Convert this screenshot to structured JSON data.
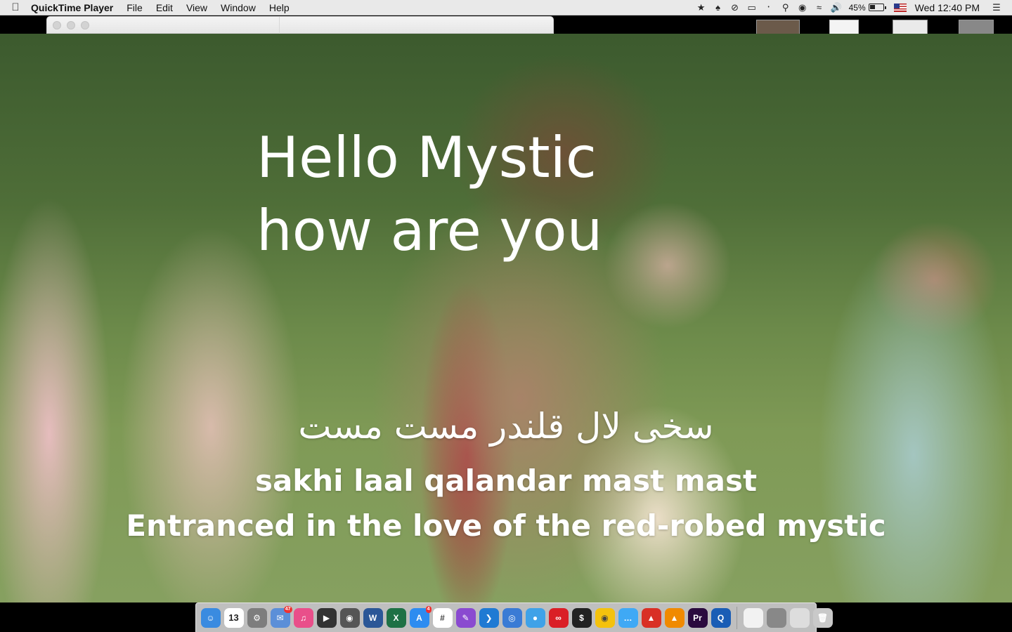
{
  "menubar": {
    "app_name": "QuickTime Player",
    "menus": [
      "File",
      "Edit",
      "View",
      "Window",
      "Help"
    ],
    "battery": "45%",
    "clock": "Wed 12:40 PM"
  },
  "subtitles": {
    "top_line_1": "Hello Mystic",
    "top_line_2": "how are you",
    "urdu": "سخی لال قلندر مست مست",
    "roman": "sakhi laal qalandar mast mast",
    "english": "Entranced in the love of the red-robed mystic"
  },
  "dock": {
    "calendar_day": "13",
    "mail_badge": "47",
    "appstore_badge": "4",
    "items": [
      {
        "name": "finder-icon",
        "color": "#3a8be0"
      },
      {
        "name": "calendar-icon",
        "color": "#ffffff"
      },
      {
        "name": "system-preferences-icon",
        "color": "#7d7d7d"
      },
      {
        "name": "mail-icon",
        "color": "#5b8fd8"
      },
      {
        "name": "itunes-icon",
        "color": "#e94f8a"
      },
      {
        "name": "final-cut-icon",
        "color": "#333333"
      },
      {
        "name": "iphoto-icon",
        "color": "#555555"
      },
      {
        "name": "word-icon",
        "color": "#2b5797"
      },
      {
        "name": "excel-icon",
        "color": "#1e7145"
      },
      {
        "name": "app-store-icon",
        "color": "#2d8cf0"
      },
      {
        "name": "slack-icon",
        "color": "#ffffff"
      },
      {
        "name": "pen-icon",
        "color": "#8a4ad0"
      },
      {
        "name": "vscode-icon",
        "color": "#1f7ad3"
      },
      {
        "name": "network-icon",
        "color": "#3a7bd5"
      },
      {
        "name": "bird-icon",
        "color": "#3fa2e8"
      },
      {
        "name": "creative-cloud-icon",
        "color": "#da1f26"
      },
      {
        "name": "terminal-icon",
        "color": "#222222"
      },
      {
        "name": "chrome-icon",
        "color": "#f4c20d"
      },
      {
        "name": "messages-icon",
        "color": "#3fa9f5"
      },
      {
        "name": "acrobat-icon",
        "color": "#d93025"
      },
      {
        "name": "vlc-icon",
        "color": "#f08a00"
      },
      {
        "name": "premiere-icon",
        "color": "#2a0a3e"
      },
      {
        "name": "quicktime-icon",
        "color": "#1a5db5"
      }
    ],
    "docs": [
      {
        "name": "document-thumbnail-icon",
        "color": "#f2f2f2"
      },
      {
        "name": "image-thumbnail-icon",
        "color": "#888888"
      },
      {
        "name": "window-thumbnail-icon",
        "color": "#dddddd"
      },
      {
        "name": "trash-icon",
        "color": "#c9c9c9"
      }
    ]
  }
}
